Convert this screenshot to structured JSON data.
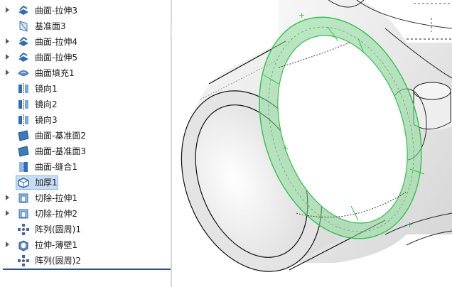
{
  "feature_tree": {
    "items": [
      {
        "label": "曲面-拉伸3",
        "icon": "surface-extrude-icon",
        "expandable": true
      },
      {
        "label": "基准面3",
        "icon": "reference-plane-icon",
        "expandable": false
      },
      {
        "label": "曲面-拉伸4",
        "icon": "surface-extrude-icon",
        "expandable": true
      },
      {
        "label": "曲面-拉伸5",
        "icon": "surface-extrude-icon",
        "expandable": true
      },
      {
        "label": "曲面填充1",
        "icon": "surface-fill-icon",
        "expandable": true
      },
      {
        "label": "镜向1",
        "icon": "mirror-icon",
        "expandable": false
      },
      {
        "label": "镜向2",
        "icon": "mirror-icon",
        "expandable": false
      },
      {
        "label": "镜向3",
        "icon": "mirror-icon",
        "expandable": false
      },
      {
        "label": "曲面-基准面2",
        "icon": "planar-surface-icon",
        "expandable": false
      },
      {
        "label": "曲面-基准面3",
        "icon": "planar-surface-icon",
        "expandable": false
      },
      {
        "label": "曲面-缝合1",
        "icon": "knit-surface-icon",
        "expandable": false
      },
      {
        "label": "加厚1",
        "icon": "thicken-icon",
        "expandable": false,
        "selected": true
      },
      {
        "label": "切除-拉伸1",
        "icon": "cut-extrude-icon",
        "expandable": true
      },
      {
        "label": "切除-拉伸2",
        "icon": "cut-extrude-icon",
        "expandable": true
      },
      {
        "label": "阵列(圆周)1",
        "icon": "circular-pattern-icon",
        "expandable": false
      },
      {
        "label": "拉伸-薄壁1",
        "icon": "thin-extrude-icon",
        "expandable": true
      },
      {
        "label": "阵列(圆周)2",
        "icon": "circular-pattern-icon",
        "expandable": false
      }
    ]
  },
  "colors": {
    "selection_fill": "#c6ddf5",
    "highlight_green": "#2fc24a",
    "icon_blue": "#2f6fb0"
  }
}
